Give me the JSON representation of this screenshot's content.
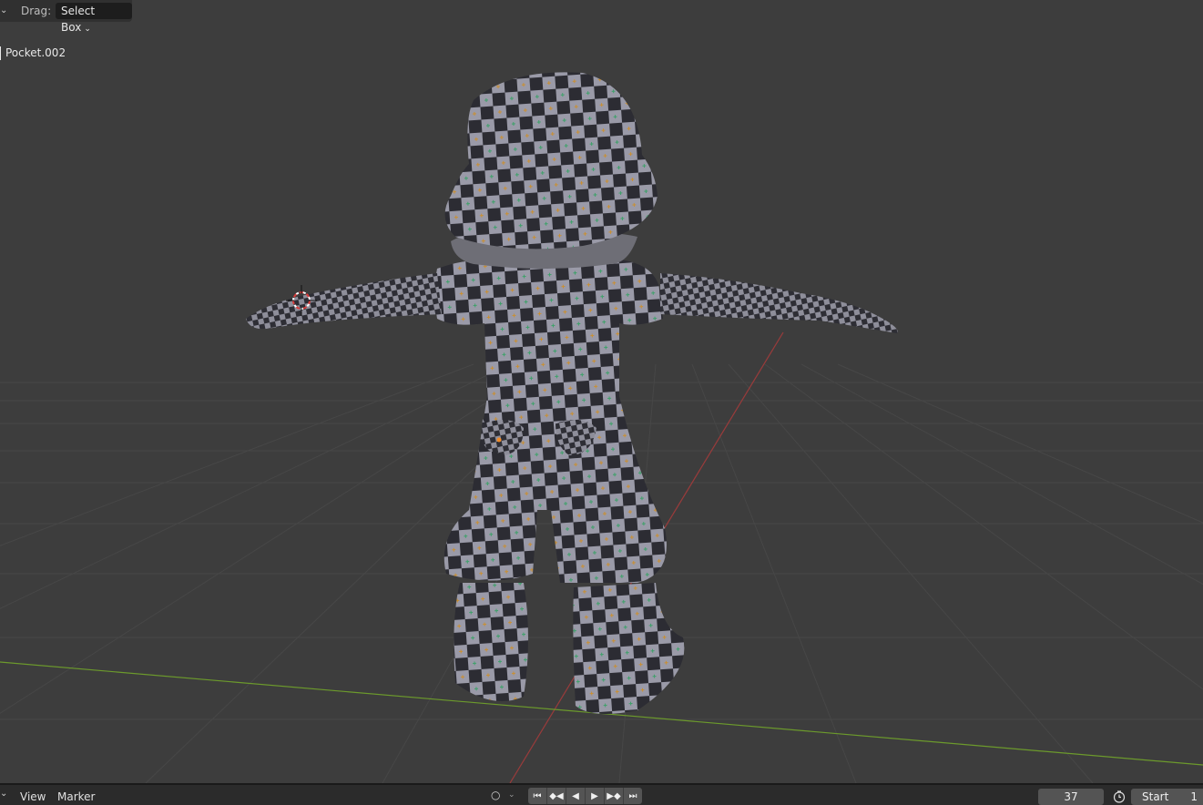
{
  "viewport": {
    "header": {
      "drag_label": "Drag:",
      "drag_mode": "Select Box"
    },
    "active_object": "Pocket.002",
    "colors": {
      "background": "#3d3d3d",
      "grid": "#4a4a4a",
      "x_axis": "#9a3b3b",
      "y_axis": "#6c9a2c",
      "cursor": "#d93b3b"
    }
  },
  "timeline": {
    "menus": [
      "View",
      "Marker"
    ],
    "current_frame": "37",
    "start_label": "Start",
    "start_value": "1",
    "playback_icons": [
      "jump-start-icon",
      "prev-keyframe-icon",
      "play-reverse-icon",
      "play-icon",
      "next-keyframe-icon",
      "jump-end-icon"
    ]
  }
}
